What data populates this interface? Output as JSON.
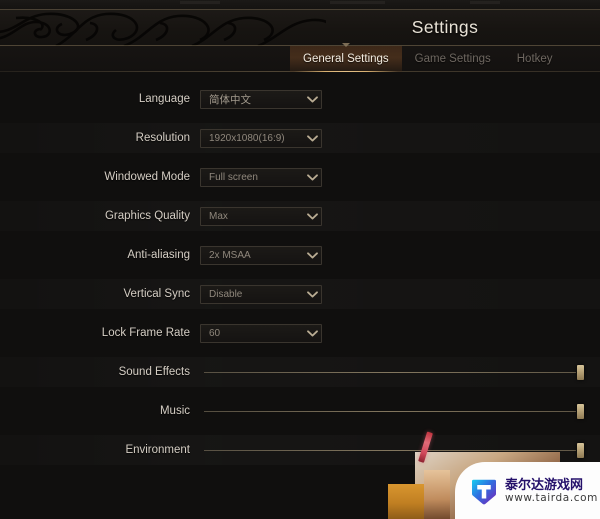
{
  "header": {
    "title": "Settings",
    "ornament_icon": "swirl-ornament-icon"
  },
  "tabs": [
    {
      "label": "General Settings",
      "active": true
    },
    {
      "label": "Game Settings",
      "active": false
    },
    {
      "label": "Hotkey",
      "active": false
    }
  ],
  "settings": [
    {
      "label": "Language",
      "type": "dropdown",
      "value": "简体中文",
      "icon": "chevron-down-icon"
    },
    {
      "label": "Resolution",
      "type": "dropdown",
      "value": "1920x1080(16:9)",
      "icon": "chevron-down-icon"
    },
    {
      "label": "Windowed Mode",
      "type": "dropdown",
      "value": "Full screen",
      "icon": "chevron-down-icon"
    },
    {
      "label": "Graphics Quality",
      "type": "dropdown",
      "value": "Max",
      "icon": "chevron-down-icon"
    },
    {
      "label": "Anti-aliasing",
      "type": "dropdown",
      "value": "2x MSAA",
      "icon": "chevron-down-icon"
    },
    {
      "label": "Vertical Sync",
      "type": "dropdown",
      "value": "Disable",
      "icon": "chevron-down-icon"
    },
    {
      "label": "Lock Frame Rate",
      "type": "dropdown",
      "value": "60",
      "icon": "chevron-down-icon"
    },
    {
      "label": "Sound Effects",
      "type": "slider",
      "value": 100
    },
    {
      "label": "Music",
      "type": "slider",
      "value": 100
    },
    {
      "label": "Environment",
      "type": "slider",
      "value": 100
    }
  ],
  "watermark": {
    "site_name": "泰尔达游戏网",
    "url": "www.tairda.com",
    "logo_icon": "tairda-shield-t-logo-icon"
  },
  "colors": {
    "background": "#100f0e",
    "accent_gold": "#d8b071",
    "active_tab_bg": "#6b4020",
    "label_text": "#d5cec4",
    "value_text": "#8f877c",
    "inactive_tab_text": "#6e6760",
    "slider_handle": "#b8a378",
    "watermark_blue": "#24106a",
    "stylus_red": "#d1485a",
    "orange_box": "#c07f22"
  }
}
